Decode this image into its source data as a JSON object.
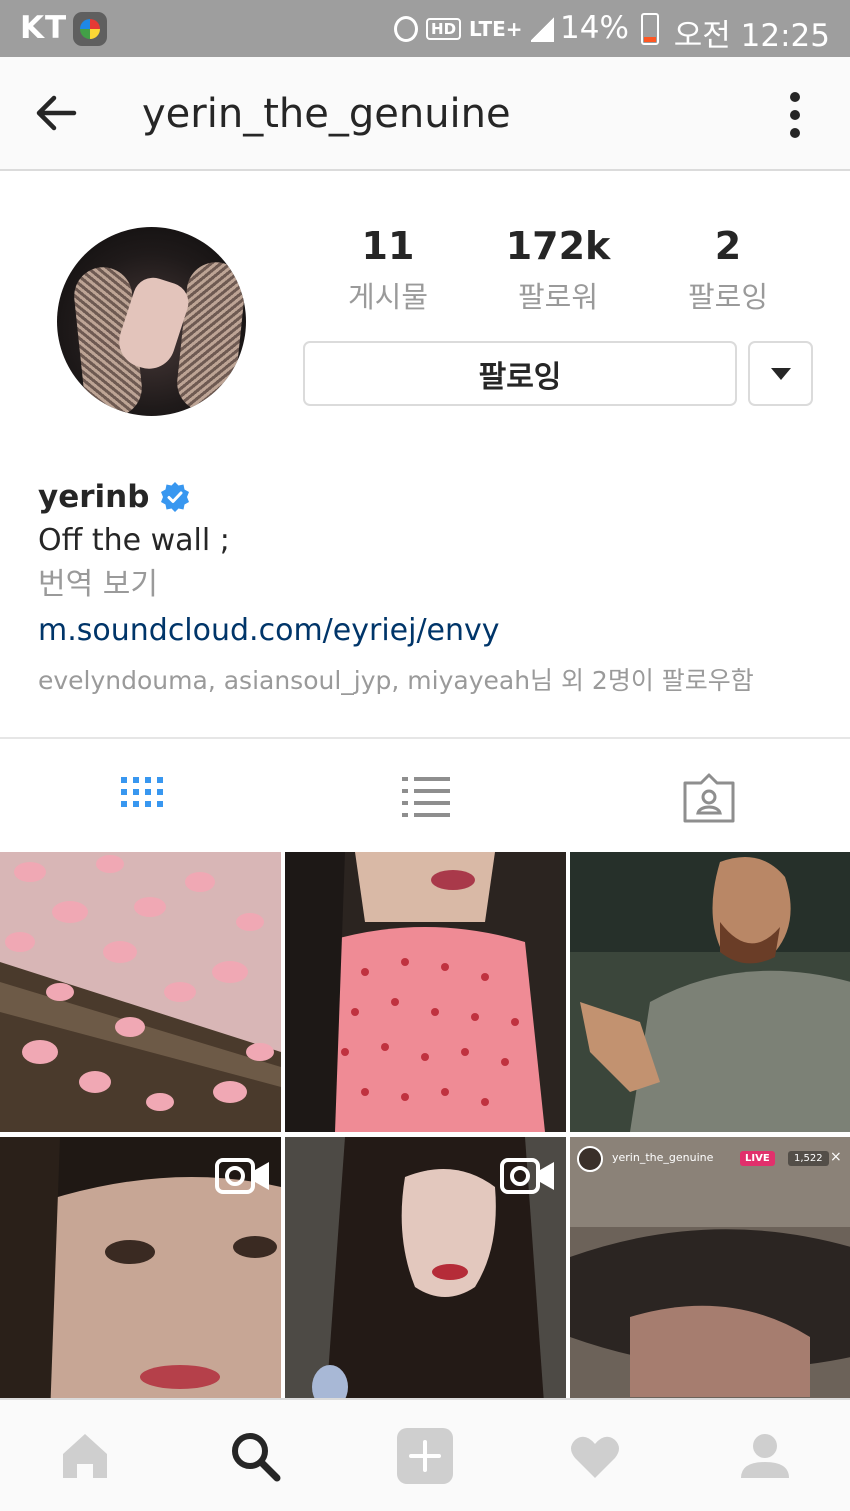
{
  "status_bar": {
    "carrier": "KT",
    "hd": "HD",
    "network": "LTE+",
    "battery": "14%",
    "time": "오전 12:25"
  },
  "header": {
    "username": "yerin_the_genuine"
  },
  "profile": {
    "stats": [
      {
        "value": "11",
        "label": "게시물"
      },
      {
        "value": "172k",
        "label": "팔로워"
      },
      {
        "value": "2",
        "label": "팔로잉"
      }
    ],
    "follow_button": "팔로잉",
    "name": "yerinb",
    "bio": "Off the wall ;",
    "translate": "번역 보기",
    "link": "m.soundcloud.com/eyriej/envy",
    "followed_by": "evelyndouma, asiansoul_jyp, miyayeah님 외 2명이 팔로우함"
  },
  "tabs": [
    "grid-view",
    "list-view",
    "tagged-view"
  ],
  "grid": {
    "live_overlay": {
      "username": "yerin_the_genuine",
      "live": "LIVE",
      "viewers": "1,522"
    }
  },
  "bottom_nav": [
    "home",
    "search",
    "add",
    "activity",
    "profile"
  ],
  "colors": {
    "accent_blue": "#3897f0",
    "link": "#003569",
    "live_red": "#e1306c"
  }
}
